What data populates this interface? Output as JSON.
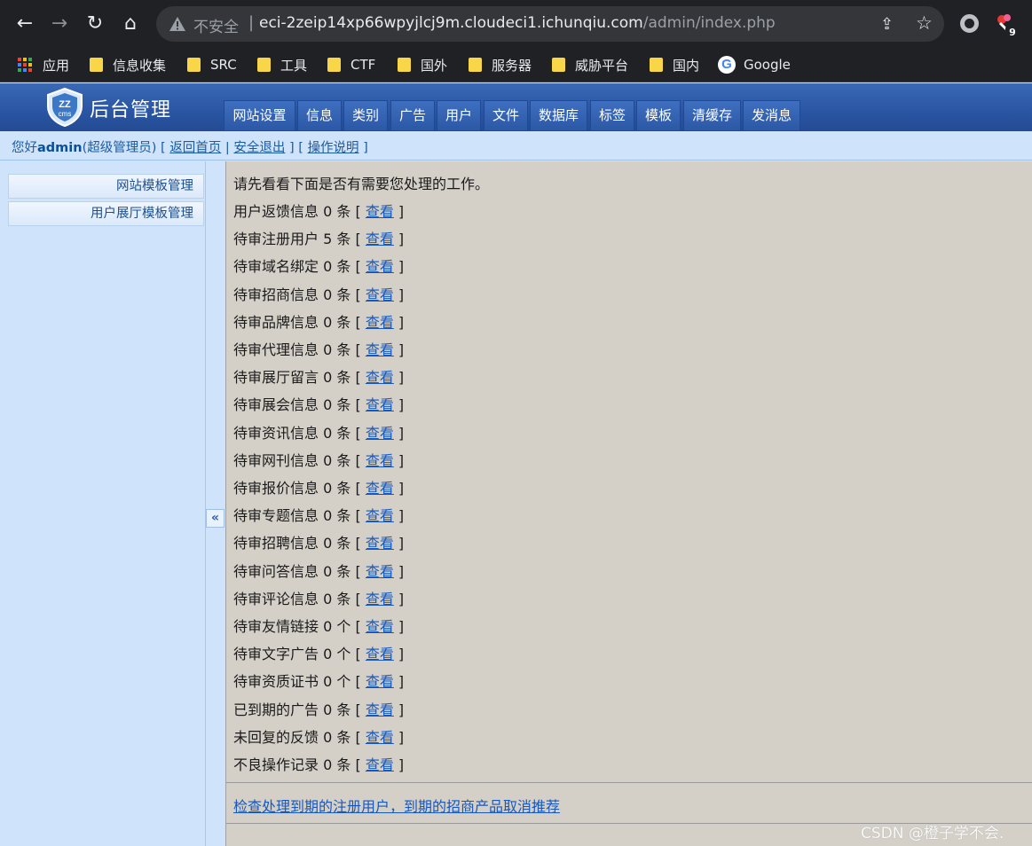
{
  "browser": {
    "insecure_label": "不安全",
    "url_host": "eci-2zeip14xp66wpyjlcj9m.cloudeci1.ichunqiu.com",
    "url_path": "/admin/index.php",
    "extension_badge": "9"
  },
  "bookmarks": [
    {
      "label": "应用",
      "icon": "apps-icon"
    },
    {
      "label": "信息收集",
      "icon": "folder-icon"
    },
    {
      "label": "SRC",
      "icon": "folder-icon"
    },
    {
      "label": "工具",
      "icon": "folder-icon"
    },
    {
      "label": "CTF",
      "icon": "folder-icon"
    },
    {
      "label": "国外",
      "icon": "folder-icon"
    },
    {
      "label": "服务器",
      "icon": "folder-icon"
    },
    {
      "label": "威胁平台",
      "icon": "folder-icon"
    },
    {
      "label": "国内",
      "icon": "folder-icon"
    },
    {
      "label": "Google",
      "icon": "google-icon"
    }
  ],
  "header": {
    "logo_text": "ZZ cms",
    "title": "后台管理",
    "menu": [
      "网站设置",
      "信息",
      "类别",
      "广告",
      "用户",
      "文件",
      "数据库",
      "标签",
      "模板",
      "清缓存",
      "发消息"
    ]
  },
  "userbar": {
    "greeting": "您好",
    "username": "admin",
    "role": "(超级管理员)",
    "links": [
      "返回首页",
      "安全退出",
      "操作说明"
    ]
  },
  "sidebar": {
    "items": [
      "网站模板管理",
      "用户展厅模板管理"
    ],
    "collapse_glyph": "«"
  },
  "main": {
    "intro": "请先看看下面是否有需要您处理的工作。",
    "view_label": "查看",
    "tasks": [
      {
        "label": "用户返馈信息",
        "count": "0",
        "unit": "条"
      },
      {
        "label": "待审注册用户",
        "count": "5",
        "unit": "条"
      },
      {
        "label": "待审域名绑定",
        "count": "0",
        "unit": "条"
      },
      {
        "label": "待审招商信息",
        "count": "0",
        "unit": "条"
      },
      {
        "label": "待审品牌信息",
        "count": "0",
        "unit": "条"
      },
      {
        "label": "待审代理信息",
        "count": "0",
        "unit": "条"
      },
      {
        "label": "待审展厅留言",
        "count": "0",
        "unit": "条"
      },
      {
        "label": "待审展会信息",
        "count": "0",
        "unit": "条"
      },
      {
        "label": "待审资讯信息",
        "count": "0",
        "unit": "条"
      },
      {
        "label": "待审网刊信息",
        "count": "0",
        "unit": "条"
      },
      {
        "label": "待审报价信息",
        "count": "0",
        "unit": "条"
      },
      {
        "label": "待审专题信息",
        "count": "0",
        "unit": "条"
      },
      {
        "label": "待审招聘信息",
        "count": "0",
        "unit": "条"
      },
      {
        "label": "待审问答信息",
        "count": "0",
        "unit": "条"
      },
      {
        "label": "待审评论信息",
        "count": "0",
        "unit": "条"
      },
      {
        "label": "待审友情链接",
        "count": "0",
        "unit": "个"
      },
      {
        "label": "待审文字广告",
        "count": "0",
        "unit": "个"
      },
      {
        "label": "待审资质证书",
        "count": "0",
        "unit": "个"
      },
      {
        "label": "已到期的广告",
        "count": "0",
        "unit": "条"
      },
      {
        "label": "未回复的反馈",
        "count": "0",
        "unit": "条"
      },
      {
        "label": "不良操作记录",
        "count": "0",
        "unit": "条"
      }
    ],
    "bottom_link": "检查处理到期的注册用户，到期的招商产品取消推荐"
  },
  "watermark": "CSDN @橙子学不会."
}
